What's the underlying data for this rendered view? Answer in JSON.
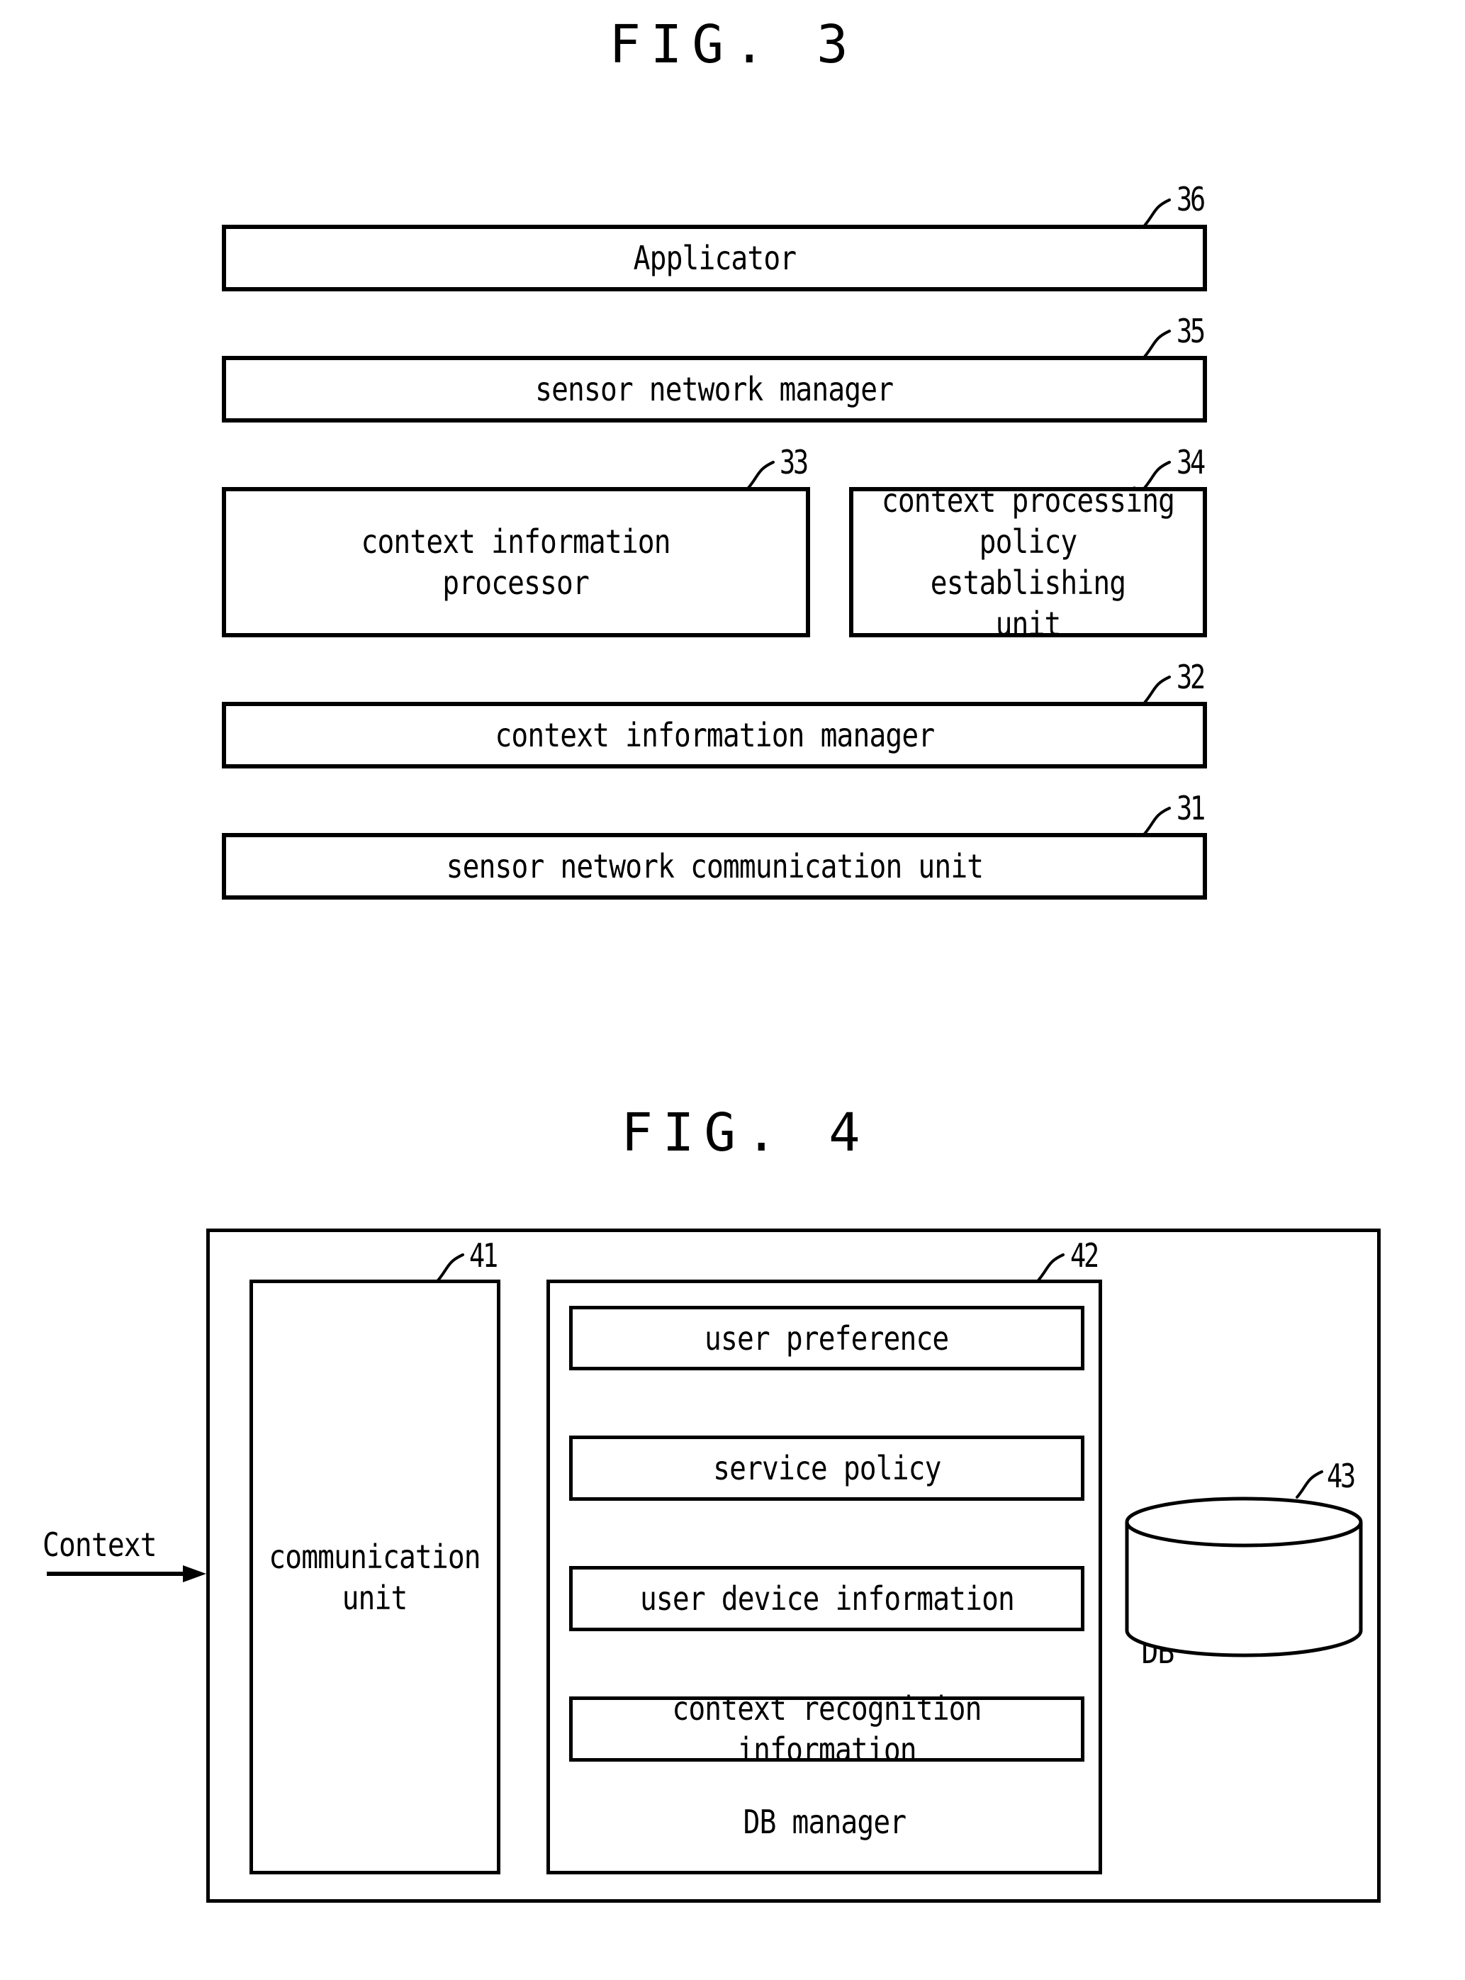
{
  "fig3": {
    "title": "FIG. 3",
    "blocks": [
      {
        "ref": "36",
        "label": "Applicator"
      },
      {
        "ref": "35",
        "label": "sensor network manager"
      },
      {
        "ref": "33",
        "label": "context information\nprocessor"
      },
      {
        "ref": "34",
        "label": "context processing\npolicy establishing\nunit"
      },
      {
        "ref": "32",
        "label": "context information manager"
      },
      {
        "ref": "31",
        "label": "sensor network communication unit"
      }
    ]
  },
  "fig4": {
    "title": "FIG. 4",
    "input_label": "Context",
    "communication_unit": {
      "ref": "41",
      "label": "communication\nunit"
    },
    "db_manager": {
      "ref": "42",
      "label": "DB manager",
      "items": [
        {
          "label": "user preference"
        },
        {
          "label": "service policy"
        },
        {
          "label": "user device information"
        },
        {
          "label": "context recognition information"
        }
      ]
    },
    "database": {
      "ref": "43",
      "label": "context\ninformation DB"
    }
  }
}
